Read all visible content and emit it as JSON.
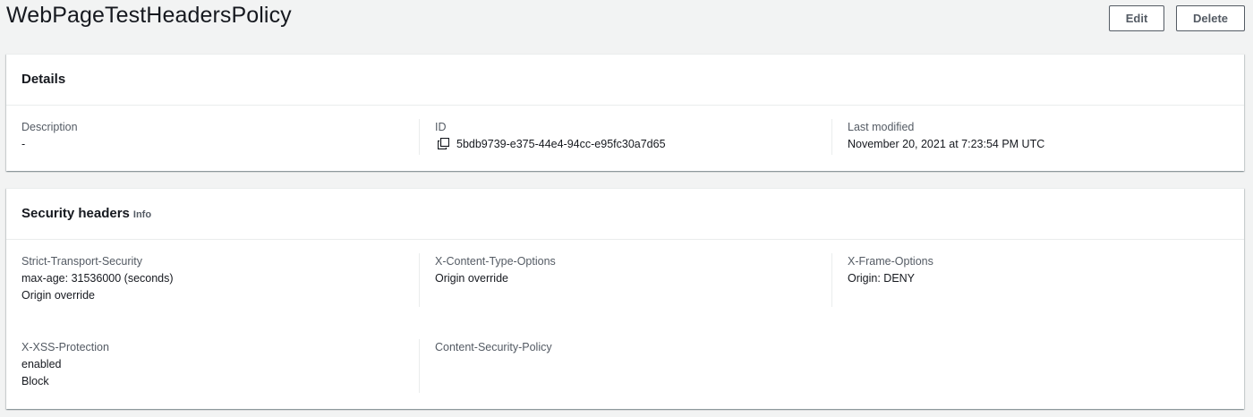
{
  "header": {
    "title": "WebPageTestHeadersPolicy",
    "edit_label": "Edit",
    "delete_label": "Delete"
  },
  "details": {
    "title": "Details",
    "description": {
      "label": "Description",
      "value": "-"
    },
    "id": {
      "label": "ID",
      "value": "5bdb9739-e375-44e4-94cc-e95fc30a7d65",
      "icon": "copy-icon"
    },
    "last_modified": {
      "label": "Last modified",
      "value": "November 20, 2021 at 7:23:54 PM UTC"
    }
  },
  "security": {
    "title": "Security headers",
    "info_label": "Info",
    "hsts": {
      "label": "Strict-Transport-Security",
      "line1": "max-age: 31536000 (seconds)",
      "line2": "Origin override"
    },
    "xcto": {
      "label": "X-Content-Type-Options",
      "line1": "Origin override"
    },
    "xfo": {
      "label": "X-Frame-Options",
      "line1": "Origin: DENY"
    },
    "xxss": {
      "label": "X-XSS-Protection",
      "line1": "enabled",
      "line2": "Block"
    },
    "csp": {
      "label": "Content-Security-Policy"
    }
  }
}
